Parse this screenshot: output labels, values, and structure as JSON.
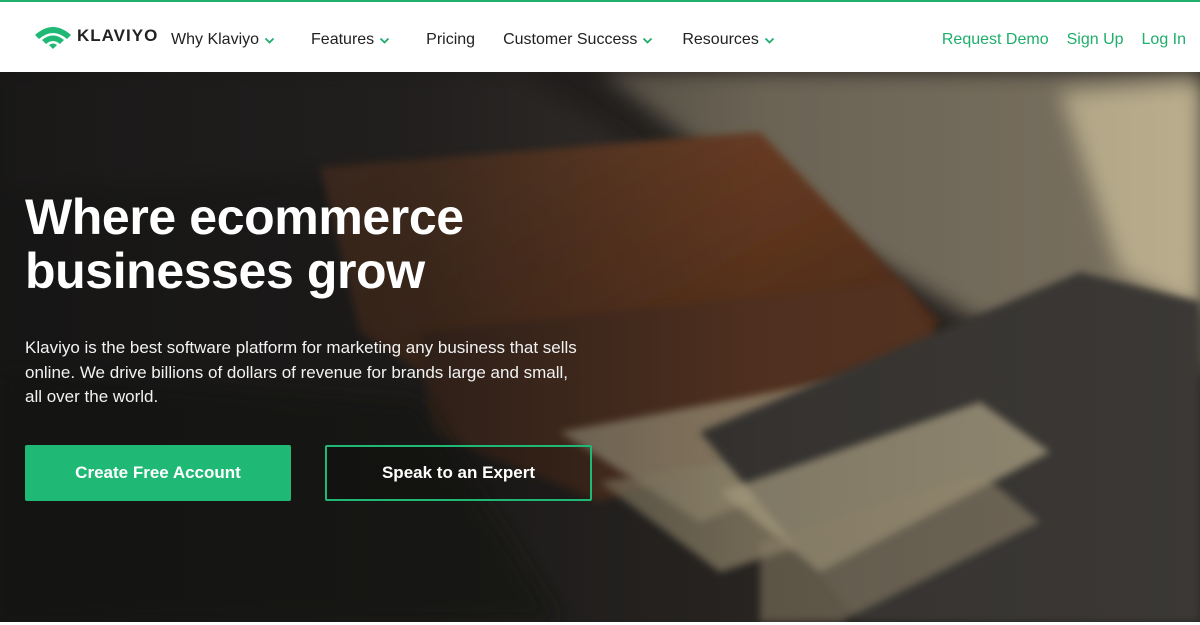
{
  "header": {
    "logo_text": "KLAVIYO",
    "nav": [
      {
        "label": "Why Klaviyo",
        "has_dropdown": true
      },
      {
        "label": "Features",
        "has_dropdown": true
      },
      {
        "label": "Pricing",
        "has_dropdown": false
      },
      {
        "label": "Customer Success",
        "has_dropdown": true
      },
      {
        "label": "Resources",
        "has_dropdown": true
      }
    ],
    "right_links": {
      "request_demo": "Request Demo",
      "sign_up": "Sign Up",
      "log_in": "Log In"
    }
  },
  "hero": {
    "headline_line1": "Where ecommerce",
    "headline_line2": "businesses grow",
    "description": "Klaviyo is the best software platform for marketing any business that sells online. We drive billions of dollars of revenue for brands large and small, all over the world.",
    "primary_cta": "Create Free Account",
    "secondary_cta": "Speak to an Expert"
  },
  "colors": {
    "brand_green": "#1fb874",
    "link_green": "#1fae6b",
    "nav_text": "#222222",
    "hero_text": "#ffffff"
  },
  "icons": {
    "logo": "klaviyo-wifi-logo-icon",
    "dropdown": "chevron-down-icon"
  }
}
